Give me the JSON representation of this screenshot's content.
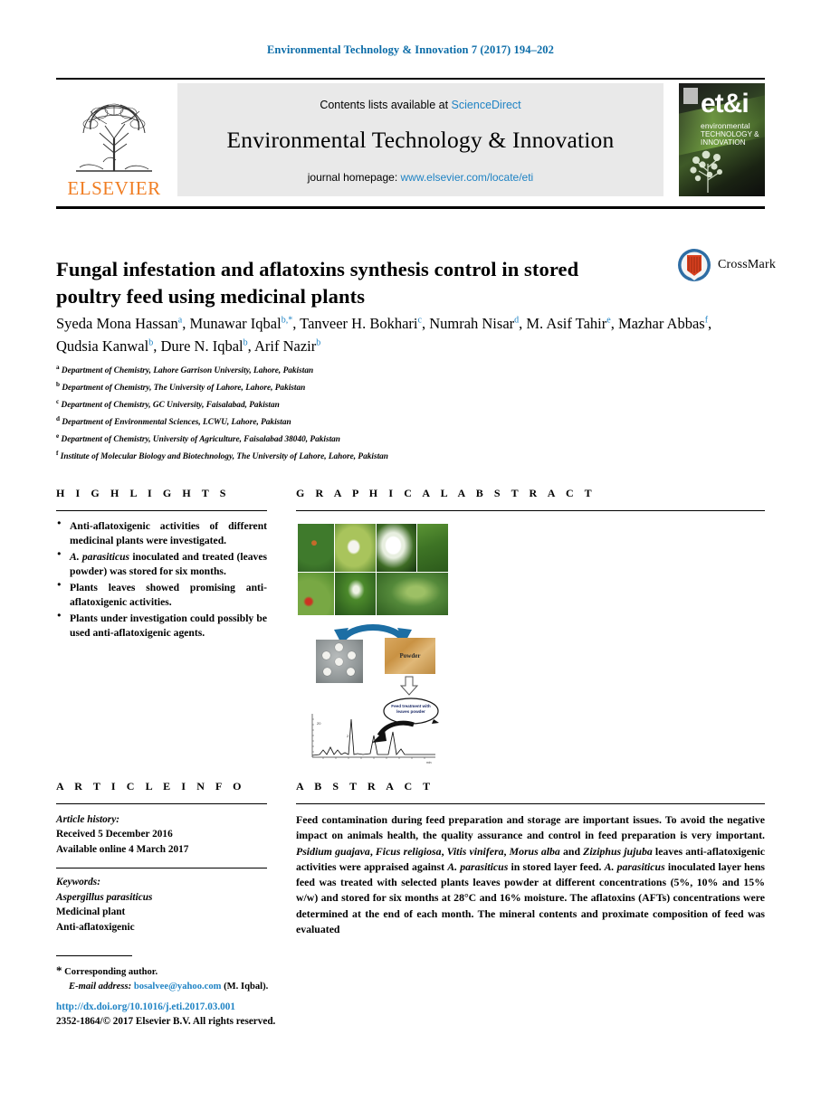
{
  "running_head": "Environmental Technology & Innovation 7 (2017) 194–202",
  "masthead": {
    "publisher": "ELSEVIER",
    "contents_prefix": "Contents lists available at",
    "contents_link": "ScienceDirect",
    "journal_name": "Environmental Technology & Innovation",
    "homepage_prefix": "journal homepage:",
    "homepage_url": "www.elsevier.com/locate/eti",
    "cover": {
      "logo_text": "et&i",
      "line1": "environmental",
      "line2": "TECHNOLOGY &",
      "line3": "INNOVATION"
    }
  },
  "article": {
    "title": "Fungal infestation and aflatoxins synthesis control in stored poultry feed using medicinal plants",
    "crossmark_label": "CrossMark",
    "authors": [
      {
        "name": "Syeda Mona Hassan",
        "marks": "a",
        "sep": ","
      },
      {
        "name": "Munawar Iqbal",
        "marks": "b,*",
        "sep": ","
      },
      {
        "name": "Tanveer H. Bokhari",
        "marks": "c",
        "sep": ","
      },
      {
        "name": "Numrah Nisar",
        "marks": "d",
        "sep": ","
      },
      {
        "name": "M. Asif Tahir",
        "marks": "e",
        "sep": ","
      },
      {
        "name": "Mazhar Abbas",
        "marks": "f",
        "sep": ","
      },
      {
        "name": "Qudsia Kanwal",
        "marks": "b",
        "sep": ","
      },
      {
        "name": "Dure N. Iqbal",
        "marks": "b",
        "sep": ","
      },
      {
        "name": "Arif Nazir",
        "marks": "b",
        "sep": ""
      }
    ],
    "affiliations": [
      {
        "mark": "a",
        "text": "Department of Chemistry, Lahore Garrison University, Lahore, Pakistan"
      },
      {
        "mark": "b",
        "text": "Department of Chemistry, The University of Lahore, Lahore, Pakistan"
      },
      {
        "mark": "c",
        "text": "Department of Chemistry, GC University, Faisalabad, Pakistan"
      },
      {
        "mark": "d",
        "text": "Department of Environmental Sciences, LCWU, Lahore, Pakistan"
      },
      {
        "mark": "e",
        "text": "Department of Chemistry, University of Agriculture, Faisalabad 38040, Pakistan"
      },
      {
        "mark": "f",
        "text": "Institute of Molecular Biology and Biotechnology, The University of Lahore, Lahore, Pakistan"
      }
    ]
  },
  "highlights": {
    "heading": "H I G H L I G H T S",
    "items": [
      {
        "pre": "Anti-aflatoxigenic activities of different medicinal plants were investigated.",
        "italic": "",
        "post": ""
      },
      {
        "pre": "",
        "italic": "A. parasiticus",
        "post": " inoculated and treated (leaves powder) was stored for six months."
      },
      {
        "pre": "Plants leaves showed promising anti-aflatoxigenic activities.",
        "italic": "",
        "post": ""
      },
      {
        "pre": "Plants under investigation could possibly be used anti-aflatoxigenic agents.",
        "italic": "",
        "post": ""
      }
    ]
  },
  "graphical_abstract": {
    "heading": "G R A P H I C A L   A B S T R A C T",
    "figure": {
      "powder_label": "Powder",
      "note_label": "Feed treatment with leaves powder",
      "photo_count": 7
    }
  },
  "article_info": {
    "heading": "A R T I C L E   I N F O",
    "history_label": "Article history:",
    "received": "Received 5 December 2016",
    "available_online": "Available online 4 March 2017",
    "keywords_label": "Keywords:",
    "keywords": [
      "Aspergillus parasiticus",
      "Medicinal plant",
      "Anti-aflatoxigenic"
    ]
  },
  "abstract": {
    "heading": "A B S T R A C T",
    "parts": [
      {
        "t": "Feed contamination during feed preparation and storage are important issues. To avoid the negative impact on animals health, the quality assurance and control in feed preparation is very important. ",
        "i": false
      },
      {
        "t": "Psidium guajava",
        "i": true
      },
      {
        "t": ", ",
        "i": false
      },
      {
        "t": "Ficus religiosa",
        "i": true
      },
      {
        "t": ", ",
        "i": false
      },
      {
        "t": "Vitis vinifera",
        "i": true
      },
      {
        "t": ", ",
        "i": false
      },
      {
        "t": "Morus alba",
        "i": true
      },
      {
        "t": " and ",
        "i": false
      },
      {
        "t": "Ziziphus jujuba",
        "i": true
      },
      {
        "t": " leaves anti-aflatoxigenic activities were appraised against ",
        "i": false
      },
      {
        "t": "A. parasiticus",
        "i": true
      },
      {
        "t": " in stored layer feed. ",
        "i": false
      },
      {
        "t": "A. parasiticus",
        "i": true
      },
      {
        "t": " inoculated layer hens feed was treated with selected plants leaves powder at different concentrations (5%, 10% and 15% w/w) and stored for six months at 28°C and 16% moisture. The aflatoxins (AFTs) concentrations were determined at the end of each month. The mineral contents and proximate composition of feed was evaluated",
        "i": false
      }
    ]
  },
  "footer": {
    "corr_star": "*",
    "corr_label": "Corresponding author.",
    "email_label": "E-mail address:",
    "email": "bosalvee@yahoo.com",
    "email_owner": "(M. Iqbal).",
    "doi": "http://dx.doi.org/10.1016/j.eti.2017.03.001",
    "copyright": "2352-1864/© 2017 Elsevier B.V. All rights reserved."
  },
  "colors": {
    "link_blue": "#1f83c4",
    "head_blue": "#0b6ca8",
    "elsevier_orange": "#f07d22"
  }
}
